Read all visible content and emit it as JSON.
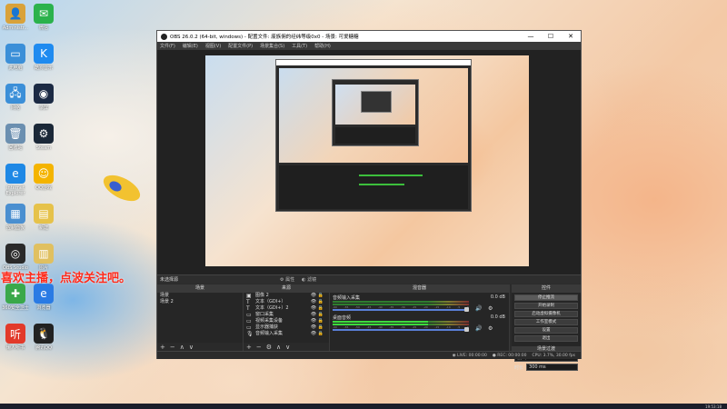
{
  "desktop": {
    "icons": [
      {
        "label": "Administr...",
        "glyph": "👤",
        "color": "#d9a23a"
      },
      {
        "label": "微信",
        "glyph": "✉",
        "color": "#2bb24c"
      },
      {
        "label": "此电脑",
        "glyph": "▭",
        "color": "#3b8fd8"
      },
      {
        "label": "酷狗音乐",
        "glyph": "K",
        "color": "#1f8bf0"
      },
      {
        "label": "网络",
        "glyph": "🖧",
        "color": "#3b8fd8"
      },
      {
        "label": "录屏",
        "glyph": "◉",
        "color": "#1b2a44"
      },
      {
        "label": "回收站",
        "glyph": "🗑",
        "color": "#6b8fb0"
      },
      {
        "label": "Steam",
        "glyph": "⚙",
        "color": "#1b2838"
      },
      {
        "label": "Internet Explorer",
        "glyph": "e",
        "color": "#1e88e5"
      },
      {
        "label": "QQ游戏",
        "glyph": "☺",
        "color": "#f4b400"
      },
      {
        "label": "控制面板",
        "glyph": "▦",
        "color": "#4a8fd0"
      },
      {
        "label": "新建",
        "glyph": "▤",
        "color": "#e6c24a"
      },
      {
        "label": "OBS Studio",
        "glyph": "◎",
        "color": "#2a2a2a"
      },
      {
        "label": "图片",
        "glyph": "▥",
        "color": "#e0c060"
      },
      {
        "label": "360安全卫士",
        "glyph": "✚",
        "color": "#3aa84a"
      },
      {
        "label": "浏览器",
        "glyph": "e",
        "color": "#2a7be4"
      },
      {
        "label": "懒人听书",
        "glyph": "听",
        "color": "#e23a2a"
      },
      {
        "label": "腾讯QQ",
        "glyph": "🐧",
        "color": "#222"
      }
    ],
    "promo_text": "喜欢主播，点波关注吧。",
    "clock": "19:53:18"
  },
  "obs": {
    "title": "OBS 26.0.2 (64-bit, windows) - 配置文件: 废族佣的经纬等级0x0 - 场景: 可爱糖糖",
    "window_controls": [
      "—",
      "☐",
      "✕"
    ],
    "menu": [
      "文件(F)",
      "编辑(E)",
      "视图(V)",
      "配置文件(P)",
      "场景集合(S)",
      "工具(T)",
      "帮助(H)"
    ],
    "scene_header": {
      "label": "未选择源",
      "properties": "属性",
      "filters": "滤镜"
    },
    "scenes": {
      "header": "场景",
      "items": [
        "场景",
        "场景 2"
      ]
    },
    "sources": {
      "header": "来源",
      "items": [
        {
          "glyph": "▣",
          "label": "图像 2"
        },
        {
          "glyph": "T",
          "label": "文本（GDI+）"
        },
        {
          "glyph": "T",
          "label": "文本（GDI+）2"
        },
        {
          "glyph": "▭",
          "label": "窗口采集"
        },
        {
          "glyph": "▭",
          "label": "视频采集设备"
        },
        {
          "glyph": "▭",
          "label": "显示器捕获"
        },
        {
          "glyph": "🎙",
          "label": "音频输入采集"
        }
      ],
      "toolbar": [
        "+",
        "−",
        "⚙",
        "∧",
        "∨"
      ]
    },
    "mixer": {
      "header": "混音器",
      "tracks": [
        {
          "name": "音频输入采集",
          "db": "0.0 dB",
          "level": 0
        },
        {
          "name": "桌面音频",
          "db": "0.0 dB",
          "level": 0.7
        }
      ],
      "ticks": [
        "-60",
        "-55",
        "-50",
        "-45",
        "-40",
        "-35",
        "-30",
        "-25",
        "-20",
        "-15",
        "-10",
        "-5",
        "0"
      ]
    },
    "controls": {
      "header": "控件",
      "buttons": [
        "停止推流",
        "开始录制",
        "启动虚拟摄像机",
        "工作室模式",
        "设置",
        "退出"
      ],
      "transition_header": "场景过渡",
      "transition": "淡出",
      "duration_label": "时长",
      "duration": "300 ms"
    },
    "status": {
      "live": "LIVE: 00:00:00",
      "rec": "REC: 00:00:00",
      "cpu": "CPU: 3.7%, 30.00 fps"
    },
    "scene_toolbar": [
      "+",
      "−",
      "∧",
      "∨"
    ]
  }
}
